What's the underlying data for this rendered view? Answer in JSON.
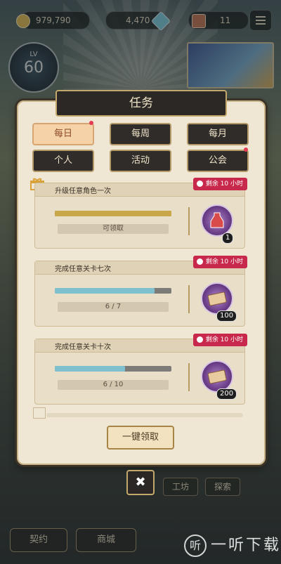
{
  "topbar": {
    "gold": "979,790",
    "gems": "4,470",
    "tickets": "11"
  },
  "player": {
    "level_label": "LV",
    "level": "60"
  },
  "panel": {
    "title": "任务",
    "tabs": [
      {
        "label": "每日",
        "active": true
      },
      {
        "label": "每周",
        "active": false
      },
      {
        "label": "每月",
        "active": false
      },
      {
        "label": "个人",
        "active": false
      },
      {
        "label": "活动",
        "active": false
      },
      {
        "label": "公会",
        "active": false
      }
    ],
    "tasks": [
      {
        "name": "升级任意角色一次",
        "timer": "剩余 10 小时",
        "status": "可领取",
        "progress": 1.0,
        "bar_color": "#c9a64a",
        "reward_icon": "potion-icon",
        "reward_count": "1"
      },
      {
        "name": "完成任意关卡七次",
        "timer": "剩余 10 小时",
        "status": "6 / 7",
        "progress": 0.857,
        "bar_color": "#7fc0cf",
        "reward_icon": "ticket-icon",
        "reward_count": "100"
      },
      {
        "name": "完成任意关卡十次",
        "timer": "剩余 10 小时",
        "status": "6 / 10",
        "progress": 0.6,
        "bar_color": "#7fc0cf",
        "reward_icon": "ticket-icon",
        "reward_count": "200"
      }
    ],
    "claim_all_label": "一键领取",
    "close_symbol": "✖"
  },
  "bottom": {
    "contract": "契约",
    "shop": "商城",
    "workshop": "工坊",
    "explore": "探索"
  },
  "watermark": {
    "logo": "听",
    "text": "一听下载"
  }
}
